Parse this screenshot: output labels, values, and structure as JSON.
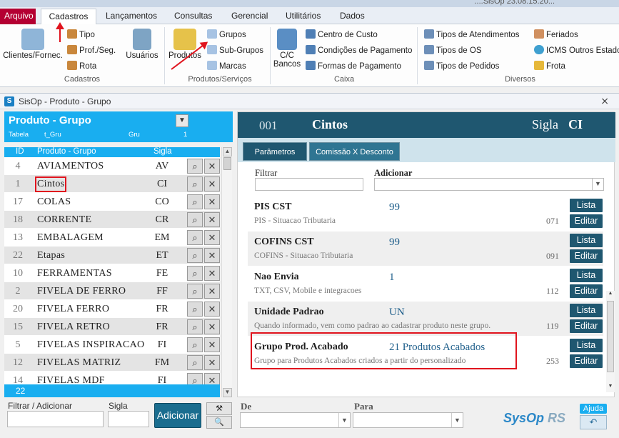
{
  "app": {
    "title_fragment": "....SisOp 23.08.15.20..."
  },
  "menu": {
    "tabs": [
      {
        "label": "Arquivo"
      },
      {
        "label": "Cadastros"
      },
      {
        "label": "Lançamentos"
      },
      {
        "label": "Consultas"
      },
      {
        "label": "Gerencial"
      },
      {
        "label": "Utilitários"
      },
      {
        "label": "Dados"
      }
    ]
  },
  "ribbon": {
    "cadastros": {
      "big": "Clientes/Fornec.",
      "items": [
        "Tipo",
        "Prof./Seg.",
        "Rota"
      ],
      "usuarios": "Usuários",
      "group_label": "Cadastros"
    },
    "produtos": {
      "big": "Produtos",
      "items": [
        "Grupos",
        "Sub-Grupos",
        "Marcas"
      ],
      "group_label": "Produtos/Serviços"
    },
    "caixa": {
      "big": "C/C\nBancos",
      "items": [
        "Centro de Custo",
        "Condições de Pagamento",
        "Formas de Pagamento"
      ],
      "group_label": "Caixa"
    },
    "diversos": {
      "items": [
        "Tipos de Atendimentos",
        "Tipos de OS",
        "Tipos de Pedidos"
      ],
      "items2": [
        "Feriados",
        "ICMS Outros Estados",
        "Frota"
      ],
      "group_label": "Diversos"
    }
  },
  "window": {
    "title": "SisOp - Produto - Grupo",
    "close": "⨯"
  },
  "left_panel": {
    "title": "Produto - Grupo",
    "meta": {
      "tabela_label": "Tabela",
      "tabela_value": "t_Gru",
      "gru_label": "Gru",
      "gru_value": "1"
    },
    "columns": {
      "id": "ID",
      "name": "Produto - Grupo",
      "sigla": "Sigla"
    },
    "rows": [
      {
        "id": "4",
        "name": "AVIAMENTOS",
        "sigla": "AV"
      },
      {
        "id": "1",
        "name": "Cintos",
        "sigla": "CI"
      },
      {
        "id": "17",
        "name": "COLAS",
        "sigla": "CO"
      },
      {
        "id": "18",
        "name": "CORRENTE",
        "sigla": "CR"
      },
      {
        "id": "13",
        "name": "EMBALAGEM",
        "sigla": "EM"
      },
      {
        "id": "22",
        "name": "Etapas",
        "sigla": "ET"
      },
      {
        "id": "10",
        "name": "FERRAMENTAS",
        "sigla": "FE"
      },
      {
        "id": "2",
        "name": "FIVELA DE FERRO",
        "sigla": "FF"
      },
      {
        "id": "20",
        "name": "FIVELA FERRO",
        "sigla": "FR"
      },
      {
        "id": "15",
        "name": "FIVELA RETRO",
        "sigla": "FR"
      },
      {
        "id": "5",
        "name": "FIVELAS INSPIRACAO",
        "sigla": "FI"
      },
      {
        "id": "12",
        "name": "FIVELAS MATRIZ",
        "sigla": "FM"
      },
      {
        "id": "14",
        "name": "FIVELAS MDF",
        "sigla": "FI"
      }
    ],
    "count": "22"
  },
  "bottom_left": {
    "filter_label": "Filtrar / Adicionar",
    "sigla_label": "Sigla",
    "add_button": "Adicionar"
  },
  "right_panel": {
    "code": "001",
    "name": "Cintos",
    "sigla_label": "Sigla",
    "sigla_value": "CI",
    "tabs": [
      "Parâmetros",
      "Comissão X Desconto"
    ],
    "filter_label": "Filtrar",
    "add_label": "Adicionar",
    "params": [
      {
        "label": "PIS CST",
        "desc": "PIS - Situacao Tributaria",
        "value": "99",
        "num": "071"
      },
      {
        "label": "COFINS CST",
        "desc": "COFINS - Situacao Tributaria",
        "value": "99",
        "num": "091"
      },
      {
        "label": "Nao Envia",
        "desc": "TXT, CSV, Mobile e integracoes",
        "value": "1",
        "num": "112"
      },
      {
        "label": "Unidade Padrao",
        "desc": "Quando informado, vem como padrao ao cadastrar produto neste grupo.",
        "value": "UN",
        "num": "119"
      },
      {
        "label": "Grupo Prod. Acabado",
        "desc": "Grupo para Produtos Acabados criados a partir do personalizado",
        "value": "21 Produtos Acabados",
        "num": "253"
      }
    ],
    "lista_label": "Lista",
    "editar_label": "Editar"
  },
  "bottom_right": {
    "de_label": "De",
    "para_label": "Para",
    "brand": "SysOp",
    "brand_suffix": "RS",
    "ajuda": "Ajuda",
    "back": "↶"
  },
  "colors": {
    "accent_blue": "#19aef0",
    "header_dark": "#1f5770",
    "highlight_red": "#e0141e",
    "arquivo_red": "#b40032"
  }
}
